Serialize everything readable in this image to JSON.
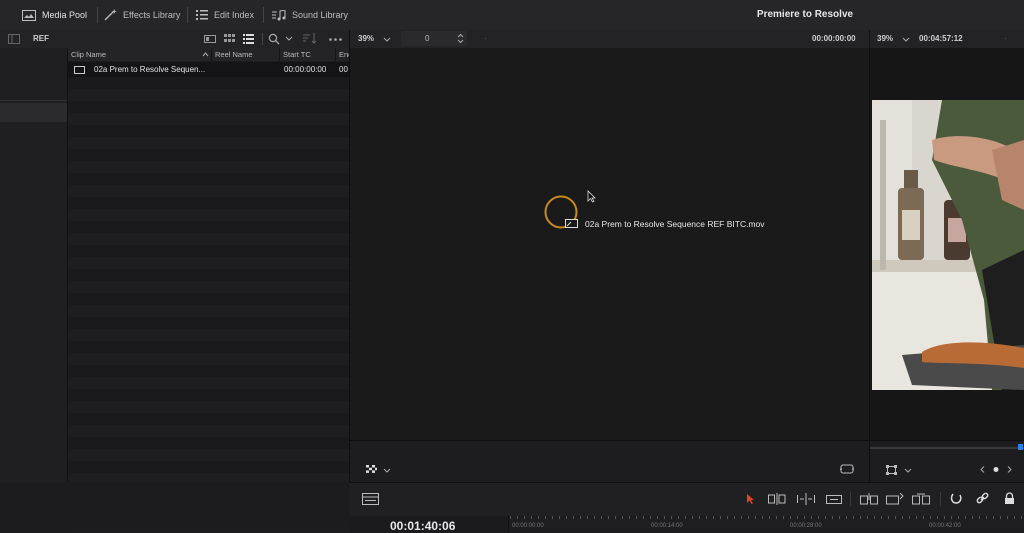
{
  "topbar": {
    "media_pool": "Media Pool",
    "effects_library": "Effects Library",
    "edit_index": "Edit Index",
    "sound_library": "Sound Library",
    "project_title": "Premiere to Resolve"
  },
  "bar2": {
    "bin_name": "REF",
    "viewer_zoom": "39%",
    "frame_value": "0",
    "source_timecode": "00:00:00:00",
    "timeline_zoom": "39%",
    "timeline_duration": "00:04:57:12"
  },
  "clip_list": {
    "columns": [
      "Clip Name",
      "Reel Name",
      "Start TC",
      "End"
    ],
    "rows": [
      {
        "clip_name": "02a Prem to Resolve Sequen...",
        "reel_name": "",
        "start_tc": "00:00:00:00",
        "end": "00"
      }
    ]
  },
  "viewer": {
    "drag_label": "02a Prem to Resolve Sequence REF BITC.mov"
  },
  "timeline": {
    "current_timecode": "00:01:40:06",
    "ruler_labels": [
      "00:00:00:00",
      "00:00:14:00",
      "00:00:28:00",
      "00:00:42:00"
    ]
  },
  "colors": {
    "accent_orange": "#c98a1e",
    "selection_red": "#e0452c",
    "playhead_blue": "#2f7fe0"
  }
}
